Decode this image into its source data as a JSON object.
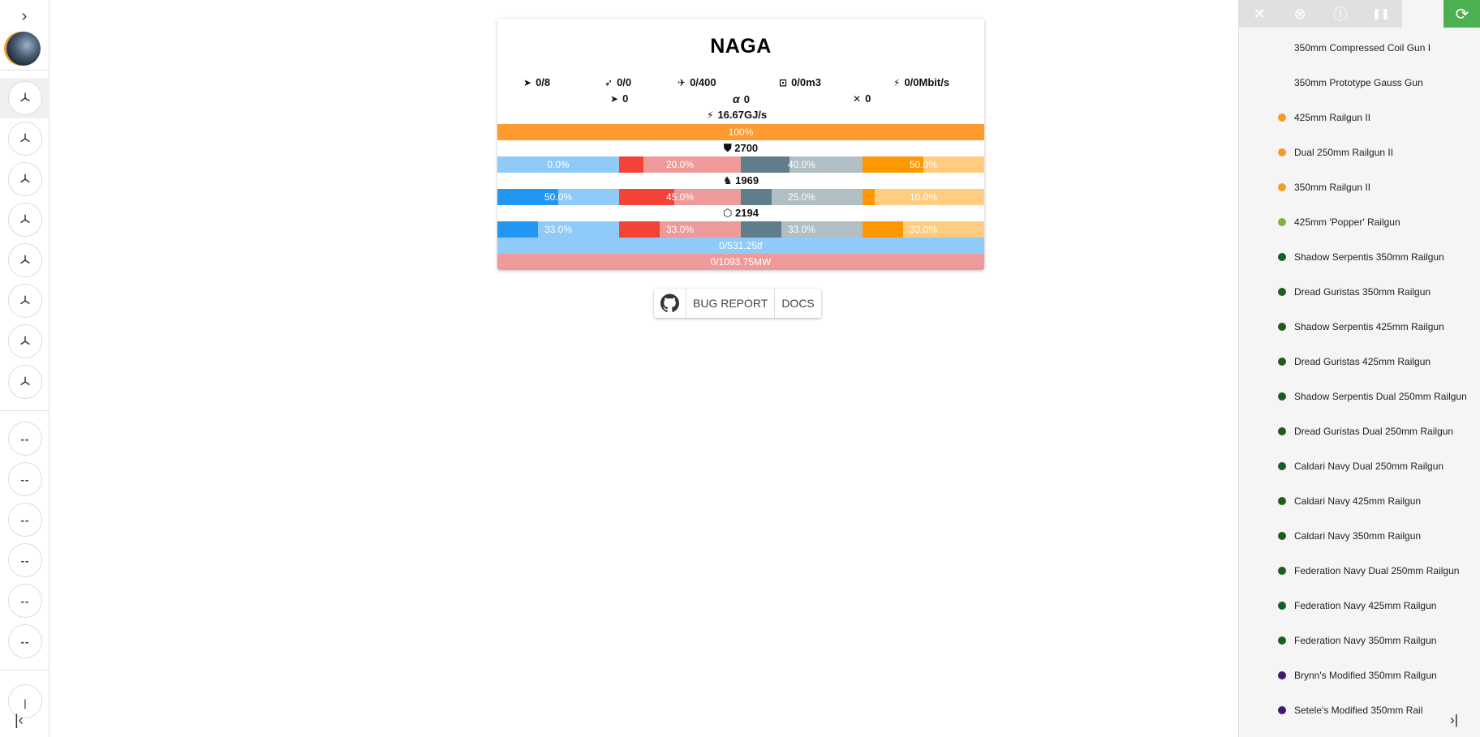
{
  "left_sidebar": {
    "expand_icon": "chevron-right",
    "collapse_icon": "first-page",
    "high_slots": [
      "triangle",
      "triangle",
      "triangle",
      "triangle",
      "triangle",
      "triangle",
      "triangle",
      "triangle"
    ],
    "mid_slots": [
      "--",
      "--",
      "--",
      "--",
      "--",
      "--"
    ],
    "partial_slot_label": "|"
  },
  "ship": {
    "name": "NAGA",
    "stats_row1": [
      {
        "icon": "turret-icon",
        "value": "0/8"
      },
      {
        "icon": "launcher-icon",
        "value": "0/0"
      },
      {
        "icon": "drone-icon",
        "value": "0/400"
      },
      {
        "icon": "cargo-icon",
        "value": "0/0m3"
      },
      {
        "icon": "bandwidth-icon",
        "value": "0/0Mbit/s"
      }
    ],
    "stats_row2": [
      {
        "icon": "dps-icon",
        "value": "0"
      },
      {
        "icon": "alpha-icon",
        "value": "0"
      },
      {
        "icon": "tools-icon",
        "value": "0"
      }
    ],
    "capacitor": "16.67GJ/s",
    "capacitor_pct": "100%",
    "shield": {
      "hp": "2700",
      "resists": [
        "0.0%",
        "20.0%",
        "40.0%",
        "50.0%"
      ],
      "fills": [
        0,
        0.2,
        0.4,
        0.5
      ]
    },
    "armor": {
      "hp": "1969",
      "resists": [
        "50.0%",
        "45.0%",
        "25.0%",
        "10.0%"
      ],
      "fills": [
        0.5,
        0.45,
        0.25,
        0.1
      ]
    },
    "hull": {
      "hp": "2194",
      "resists": [
        "33.0%",
        "33.0%",
        "33.0%",
        "33.0%"
      ],
      "fills": [
        0.33,
        0.33,
        0.33,
        0.33
      ]
    },
    "cpu": "0/531.25tf",
    "power": "0/1093.75MW",
    "colors": {
      "em_dark": "#2196f3",
      "em_light": "#90caf9",
      "therm_dark": "#f44336",
      "therm_light": "#ef9a9a",
      "kin_dark": "#607d8b",
      "kin_light": "#b0bec5",
      "exp_dark": "#ff9800",
      "exp_light": "#ffcc80",
      "cap": "#ff9a2e"
    }
  },
  "buttons": {
    "github_icon": "github-icon",
    "bug_report": "BUG REPORT",
    "docs": "DOCS"
  },
  "right_panel": {
    "toolbar": [
      "close-icon",
      "cancel-circle-icon",
      "info-icon",
      "pause-icon",
      "sync-icon"
    ],
    "items": [
      {
        "label": "350mm Compressed Coil Gun I",
        "dot": ""
      },
      {
        "label": "350mm Prototype Gauss Gun",
        "dot": ""
      },
      {
        "label": "425mm Railgun II",
        "dot": "#f39c2e"
      },
      {
        "label": "Dual 250mm Railgun II",
        "dot": "#f39c2e"
      },
      {
        "label": "350mm Railgun II",
        "dot": "#f39c2e"
      },
      {
        "label": "425mm 'Popper' Railgun",
        "dot": "#7cb342"
      },
      {
        "label": "Shadow Serpentis 350mm Railgun",
        "dot": "#1b5e20"
      },
      {
        "label": "Dread Guristas 350mm Railgun",
        "dot": "#1b5e20"
      },
      {
        "label": "Shadow Serpentis 425mm Railgun",
        "dot": "#1b5e20"
      },
      {
        "label": "Dread Guristas 425mm Railgun",
        "dot": "#1b5e20"
      },
      {
        "label": "Shadow Serpentis Dual 250mm Railgun",
        "dot": "#1b5e20"
      },
      {
        "label": "Dread Guristas Dual 250mm Railgun",
        "dot": "#1b5e20"
      },
      {
        "label": "Caldari Navy Dual 250mm Railgun",
        "dot": "#1b5e20"
      },
      {
        "label": "Caldari Navy 425mm Railgun",
        "dot": "#1b5e20"
      },
      {
        "label": "Caldari Navy 350mm Railgun",
        "dot": "#1b5e20"
      },
      {
        "label": "Federation Navy Dual 250mm Railgun",
        "dot": "#1b5e20"
      },
      {
        "label": "Federation Navy 425mm Railgun",
        "dot": "#1b5e20"
      },
      {
        "label": "Federation Navy 350mm Railgun",
        "dot": "#1b5e20"
      },
      {
        "label": "Brynn's Modified 350mm Railgun",
        "dot": "#3f1a6e"
      },
      {
        "label": "Setele's Modified 350mm Rail",
        "dot": "#3f1a6e"
      }
    ],
    "collapse_icon": "last-page"
  }
}
